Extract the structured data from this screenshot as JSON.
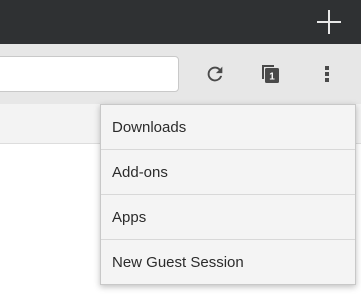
{
  "toolbar": {
    "url_value": "",
    "url_placeholder": "",
    "tab_count": "1"
  },
  "icons": {
    "new_tab": "plus-icon",
    "reload": "reload-icon",
    "tabs": "tabs-counter-icon",
    "menu": "overflow-menu-icon"
  },
  "menu": {
    "items": [
      {
        "label": "Downloads"
      },
      {
        "label": "Add-ons"
      },
      {
        "label": "Apps"
      },
      {
        "label": "New Guest Session"
      }
    ]
  },
  "colors": {
    "tab_strip": "#2f3133",
    "toolbar": "#e7e7e7",
    "menu_bg": "#f4f4f4",
    "menu_text": "#2b2b2b",
    "icon": "#4a4a4a"
  }
}
